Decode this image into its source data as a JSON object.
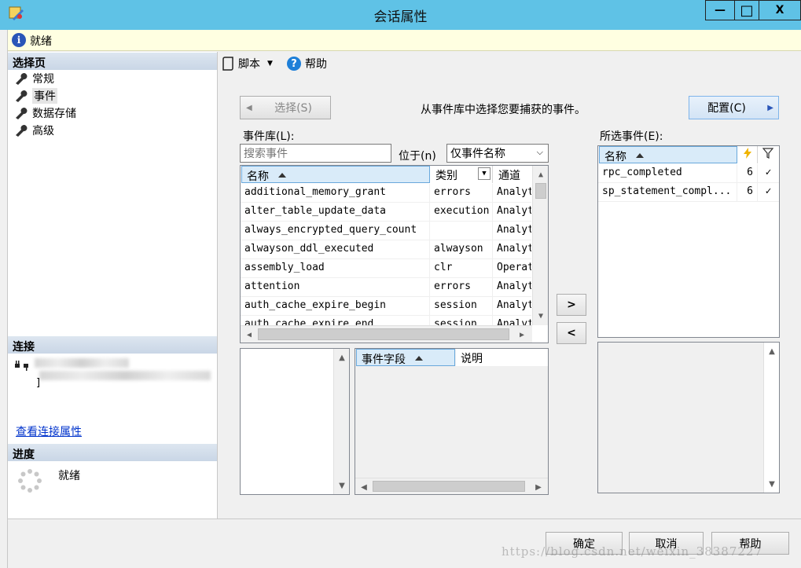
{
  "window": {
    "title": "会话属性",
    "minimize": "—",
    "maximize": "□",
    "close": "X"
  },
  "status_bar": {
    "text": "就绪"
  },
  "left": {
    "select_page_header": "选择页",
    "pages": [
      "常规",
      "事件",
      "数据存储",
      "高级"
    ],
    "connection_header": "连接",
    "view_connection_link": "查看连接属性",
    "progress_header": "进度",
    "progress_status": "就绪"
  },
  "toolbar": {
    "script_label": "脚本",
    "help_label": "帮助"
  },
  "event_select": {
    "select_button": "选择(S)",
    "instruction": "从事件库中选择您要捕获的事件。",
    "config_button": "配置(C)",
    "library_label": "事件库(L):",
    "search_placeholder": "搜索事件",
    "located_in_label": "位于(n)",
    "filter_option": "仅事件名称",
    "selected_label": "所选事件(E):",
    "add_arrow": ">",
    "remove_arrow": "<"
  },
  "library_table": {
    "headers": [
      "名称",
      "类别",
      "通道"
    ],
    "rows": [
      [
        "additional_memory_grant",
        "errors",
        "Analyt"
      ],
      [
        "alter_table_update_data",
        "execution",
        "Analyt"
      ],
      [
        "always_encrypted_query_count",
        "",
        "Analyt"
      ],
      [
        "alwayson_ddl_executed",
        "alwayson",
        "Analyt"
      ],
      [
        "assembly_load",
        "clr",
        "Operat"
      ],
      [
        "attention",
        "errors",
        "Analyt"
      ],
      [
        "auth_cache_expire_begin",
        "session",
        "Analyt"
      ],
      [
        "auth_cache_expire_end",
        "session",
        "Analyt"
      ]
    ]
  },
  "selected_table": {
    "headers": [
      "名称"
    ],
    "rows": [
      [
        "rpc_completed",
        "6",
        "✓"
      ],
      [
        "sp_statement_compl...",
        "6",
        "✓"
      ]
    ]
  },
  "fields_table": {
    "headers": [
      "事件字段",
      "说明"
    ]
  },
  "buttons": {
    "ok": "确定",
    "cancel": "取消",
    "help": "帮助"
  },
  "watermark": "https://blog.csdn.net/weixin_38387227",
  "colors": {
    "titlebar": "#5fc2e6",
    "infobar": "#ffffe1",
    "header_selected": "#d9ebf9"
  }
}
